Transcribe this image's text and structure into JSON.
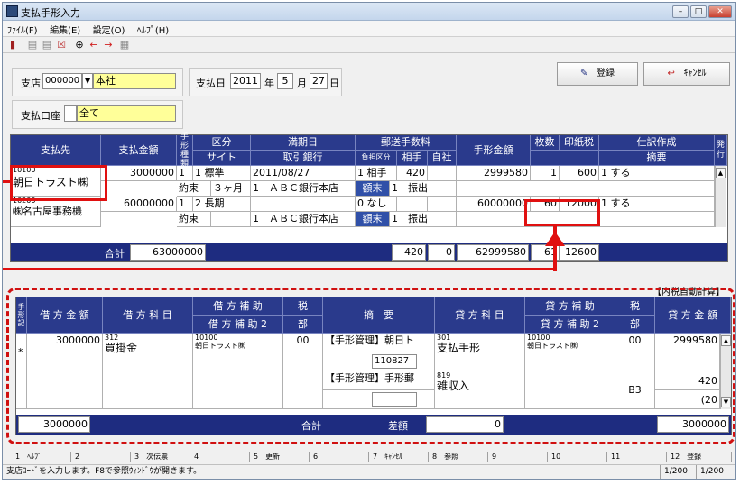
{
  "window": {
    "title": "支払手形入力"
  },
  "menu": [
    "ﾌｧｲﾙ(F)",
    "編集(E)",
    "設定(O)",
    "ﾍﾙﾌﾟ(H)"
  ],
  "header": {
    "shiten_label": "支店",
    "shiten_code": "000000",
    "shiten_name": "本社",
    "shiharaibi_label": "支払日",
    "year": "2011",
    "year_unit": "年",
    "month": "5",
    "month_unit": "月",
    "day": "27",
    "day_unit": "日",
    "koza_label": "支払口座",
    "koza_name": "全て",
    "register": "登録",
    "cancel": "ｷｬﾝｾﾙ"
  },
  "top_grid": {
    "headers": {
      "shiharaisaki": "支払先",
      "kingaku": "支払金額",
      "shurui": "手形種類",
      "kubun": "区分",
      "site": "サイト",
      "manki": "満期日",
      "torihiki": "取引銀行",
      "yuso": "郵送手数料",
      "futan": "負担区分",
      "aite": "相手",
      "jisha": "自社",
      "tegata_kingaku": "手形金額",
      "maisu": "枚数",
      "inshi": "印紙税",
      "shiwake": "仕訳作成",
      "tekiyo": "摘要",
      "hakko": "発行"
    },
    "rows": [
      {
        "code": "10100",
        "name": "朝日トラスト㈱",
        "amount": "3000000",
        "type": "1",
        "kubun": "1 標準",
        "due": "2011/08/27",
        "fee_kubun": "1 相手",
        "fee": "420",
        "tegata": "2999580",
        "count": "1",
        "stamp": "600",
        "journal": "1 する",
        "yakuso": "約束",
        "site": "３ヶ月",
        "bank": "1　ＡＢＣ銀行本店",
        "getsumatsu": "額末",
        "shukko": "1　振出"
      },
      {
        "code": "10200",
        "name": "㈱名古屋事務機",
        "amount": "60000000",
        "type": "1",
        "kubun": "2 長期",
        "due": "",
        "fee_kubun": "0 なし",
        "fee": "",
        "tegata": "60000000",
        "count": "60",
        "stamp": "12000",
        "journal": "1 する",
        "yakuso": "約束",
        "site": "",
        "bank": "1　ＡＢＣ銀行本店",
        "getsumatsu": "額末",
        "shukko": "1　振出"
      }
    ],
    "total": {
      "label": "合計",
      "amount": "63000000",
      "fee": "420",
      "jisha": "0",
      "tegata": "62999580",
      "count": "61",
      "stamp": "12600"
    }
  },
  "naizei": "【内税自動計算】",
  "bottom_grid": {
    "headers": {
      "mark": "手形記",
      "kari_kingaku": "借 方 金 額",
      "kari_kamoku": "借 方 科 目",
      "kari_hojo": "借 方 補 助",
      "kari_hojo2": "借 方 補 助 2",
      "zei": "税",
      "bu": "部",
      "tekiyo": "摘　要",
      "kashi_kamoku": "貸 方 科 目",
      "kashi_hojo": "貸 方 補 助",
      "kashi_hojo2": "貸 方 補 助 2",
      "kashi_kingaku": "貸 方 金 額"
    },
    "rows": [
      {
        "mark": "*",
        "kari_amount": "3000000",
        "kari_code": "312",
        "kari_name": "買掛金",
        "kari_hojo_code": "10100",
        "kari_hojo_name": "朝日トラスト㈱",
        "zei": "00",
        "tekiyo": "【手形管理】朝日ト",
        "tekiyo_no": "110827",
        "kashi_code": "301",
        "kashi_name": "支払手形",
        "kashi_hojo_code": "10100",
        "kashi_hojo_name": "朝日トラスト㈱",
        "kashi_zei": "00",
        "kashi_amount": "2999580"
      },
      {
        "mark": "",
        "kari_amount": "",
        "kari_code": "",
        "kari_name": "",
        "kari_hojo_code": "",
        "kari_hojo_name": "",
        "zei": "",
        "tekiyo": "【手形管理】手形郵",
        "tekiyo_no": "",
        "kashi_code": "819",
        "kashi_name": "雑収入",
        "kashi_hojo_code": "",
        "kashi_hojo_name": "",
        "kashi_zei": "B3",
        "kashi_amount": "420",
        "kashi_amount2": "(20"
      }
    ],
    "total": {
      "kari": "3000000",
      "label": "合計",
      "sagaku_label": "差額",
      "sagaku": "0",
      "kashi": "3000000"
    }
  },
  "fkeys": [
    "1　ﾍﾙﾌﾟ",
    "2",
    "3　次伝票",
    "4",
    "5　更新",
    "6",
    "7　ｷｬﾝｾﾙ",
    "8　参照",
    "9",
    "10",
    "11",
    "12　登録"
  ],
  "status": {
    "message": "支店ｺｰﾄﾞを入力します。F8で参照ｳｨﾝﾄﾞｳが開きます。",
    "page1": "1/200",
    "page2": "1/200"
  }
}
